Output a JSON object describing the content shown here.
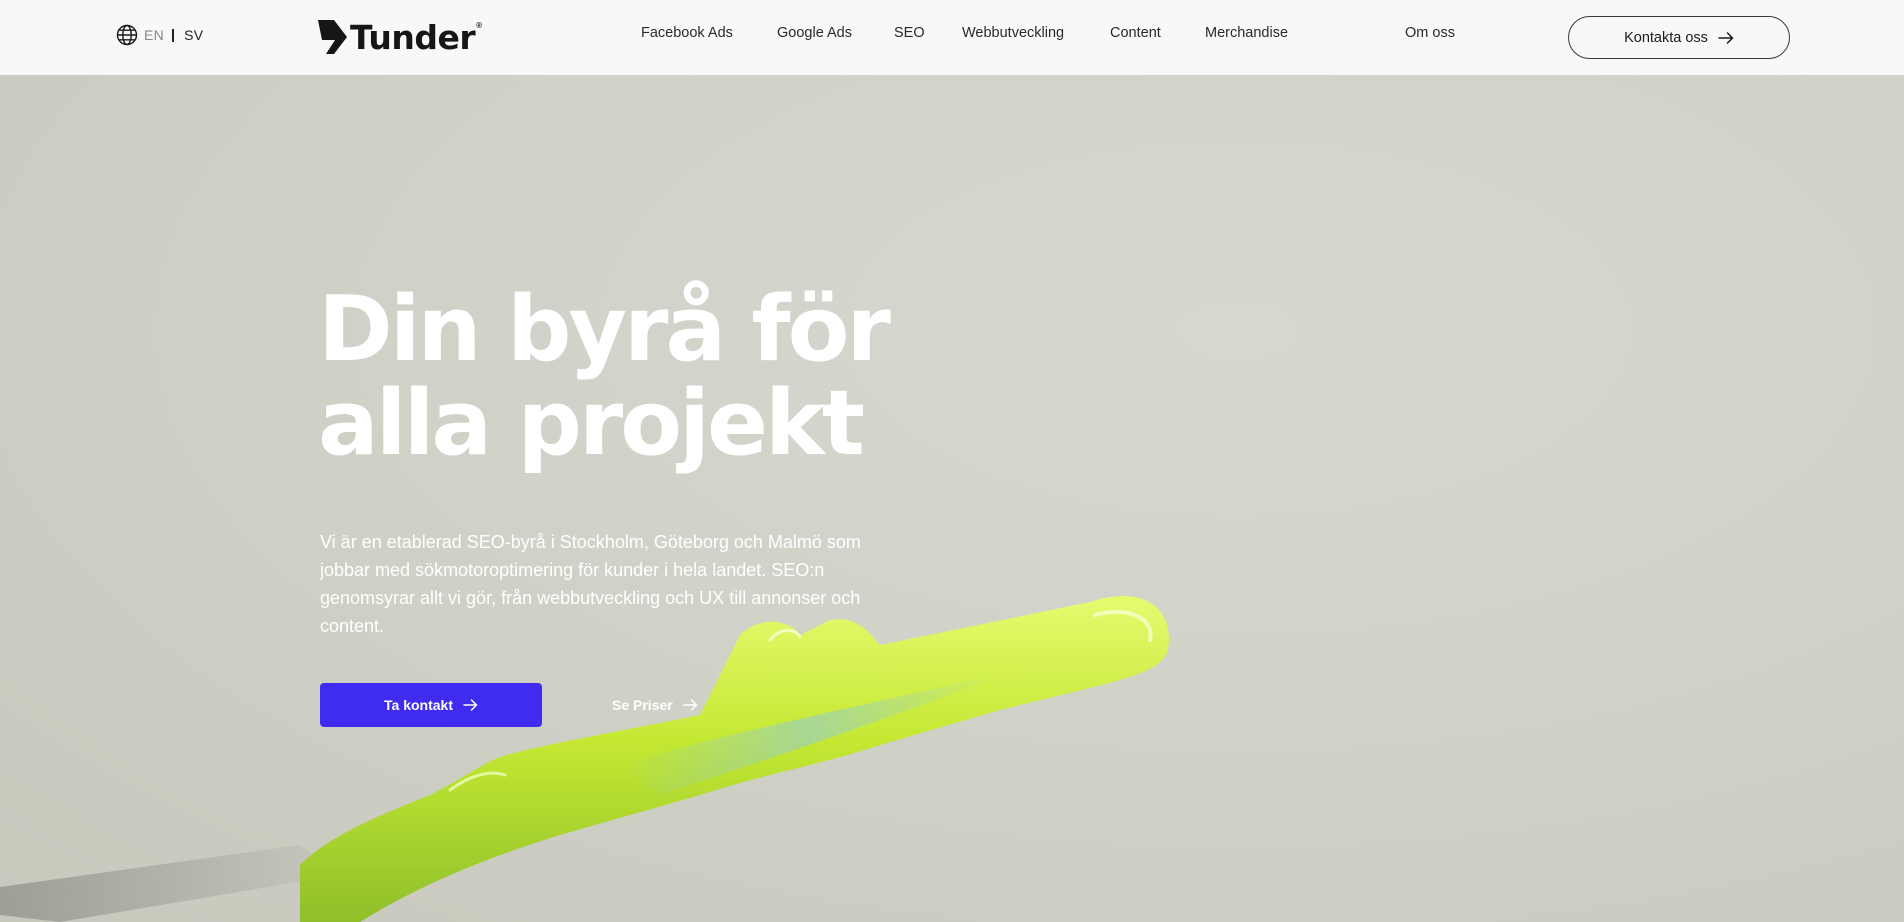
{
  "header": {
    "lang": {
      "globe_icon": "globe-icon",
      "en": "EN",
      "sv": "SV"
    },
    "logo": {
      "text": "Tunder",
      "reg": "®"
    },
    "nav": [
      {
        "label": "Facebook Ads"
      },
      {
        "label": "Google Ads"
      },
      {
        "label": "SEO"
      },
      {
        "label": "Webbutveckling"
      },
      {
        "label": "Content"
      },
      {
        "label": "Merchandise"
      }
    ],
    "about": "Om oss",
    "contact_label": "Kontakta oss",
    "contact_icon": "arrow-right-icon"
  },
  "hero": {
    "title_line1": "Din byrå för",
    "title_line2": "alla projekt",
    "description": "Vi är en etablerad SEO-byrå i Stockholm, Göteborg och Malmö som jobbar med sökmotoroptimering för kunder i hela landet. SEO:n genomsyrar allt vi gör, från webbutveckling och UX till annonser och content.",
    "cta_primary": "Ta kontakt",
    "cta_secondary": "Se Priser"
  },
  "colors": {
    "accent": "#3f2cf0",
    "header_bg": "#f7f8f9",
    "hero_bg": "#d3d4cb",
    "art_green": "#c4e832"
  }
}
